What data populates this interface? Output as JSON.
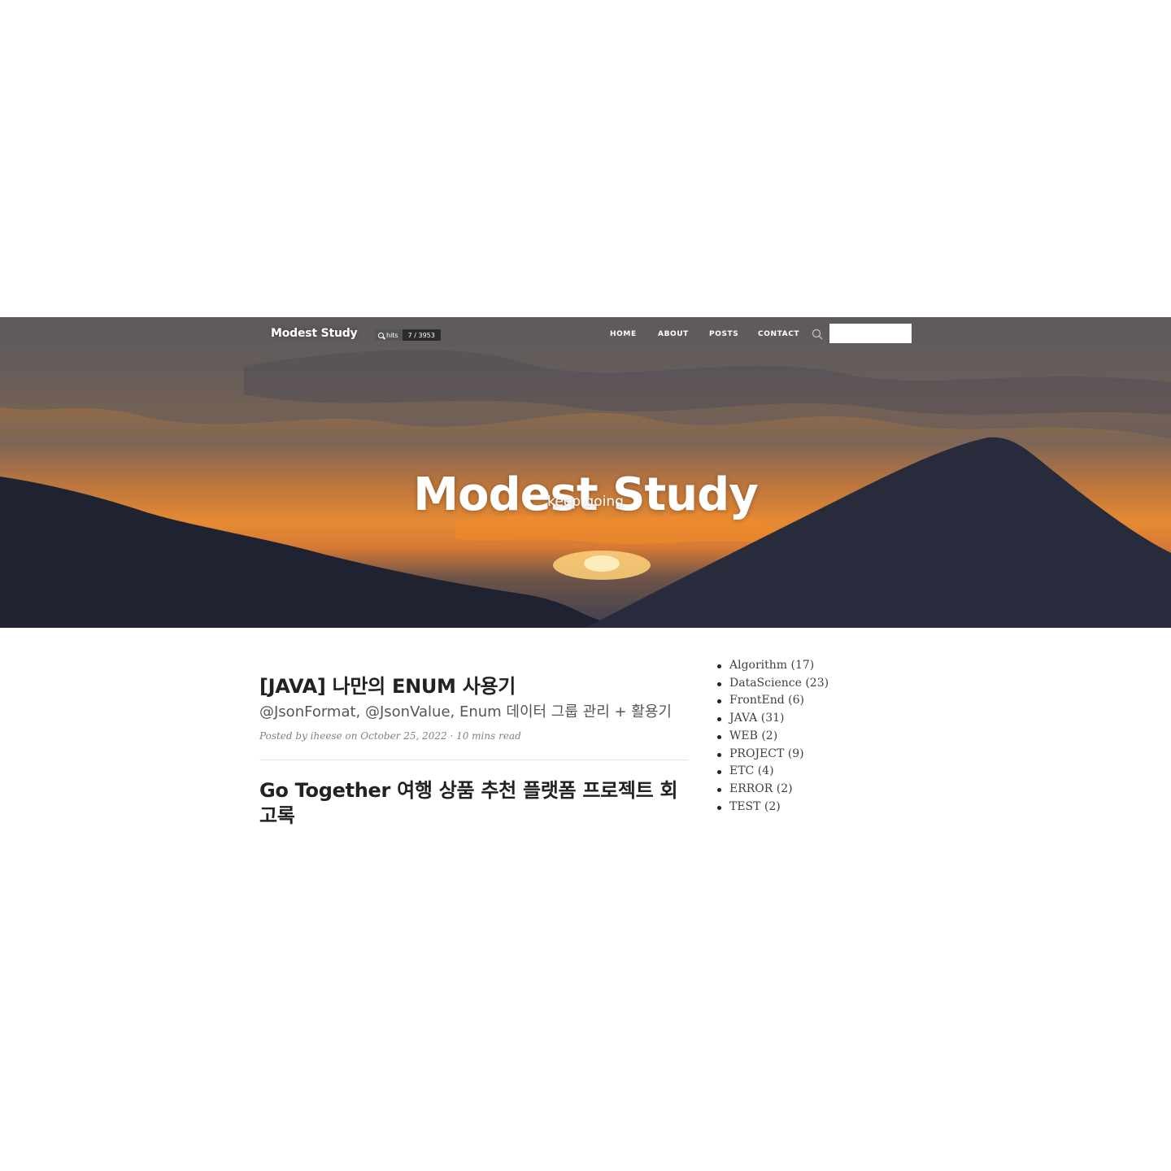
{
  "navbar": {
    "brand": "Modest Study",
    "hits": {
      "label": "hits",
      "count": "7 / 3953"
    },
    "links": [
      "HOME",
      "ABOUT",
      "POSTS",
      "CONTACT"
    ],
    "search": {
      "icon": "search-icon",
      "value": ""
    }
  },
  "hero": {
    "title": "Modest Study",
    "subtitle": "keep going"
  },
  "posts": [
    {
      "title": "[JAVA] 나만의 ENUM 사용기",
      "subtitle": "@JsonFormat, @JsonValue, Enum 데이터 그룹 관리 + 활용기",
      "meta": "Posted by iheese on October 25, 2022 · 10 mins read"
    },
    {
      "title": "Go Together 여행 상품 추천 플랫폼 프로젝트 회고록"
    }
  ],
  "categories": [
    "Algorithm (17)",
    "DataScience (23)",
    "FrontEnd (6)",
    "JAVA (31)",
    "WEB (2)",
    "PROJECT (9)",
    "ETC (4)",
    "ERROR (2)",
    "TEST (2)"
  ],
  "colors": {
    "background": "#ffffff",
    "title_text": "#222222",
    "subtitle_text": "#555555",
    "meta_text": "#808080",
    "hits_left": "#555555",
    "hits_right": "#2b2b2b"
  }
}
